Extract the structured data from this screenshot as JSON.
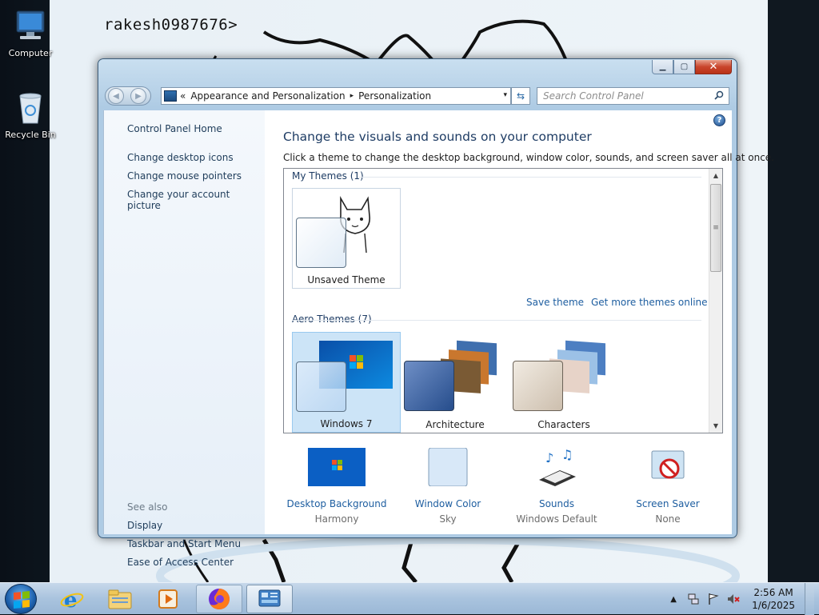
{
  "desktop": {
    "user_text": "rakesh0987676>",
    "icons": [
      {
        "label": "Computer",
        "icon": "computer-icon"
      },
      {
        "label": "Recycle Bin",
        "icon": "recycle-bin-icon"
      }
    ]
  },
  "window": {
    "caption_buttons": {
      "minimize": "minimize-icon",
      "maximize": "maximize-icon",
      "close": "close-icon"
    },
    "address": {
      "overflow": "«",
      "crumbs": [
        "Appearance and Personalization",
        "Personalization"
      ],
      "separator": "▸",
      "dropdown": "▾"
    },
    "search": {
      "placeholder": "Search Control Panel"
    },
    "left_pane": {
      "home": "Control Panel Home",
      "links": [
        "Change desktop icons",
        "Change mouse pointers",
        "Change your account picture"
      ],
      "see_also_label": "See also",
      "see_also": [
        "Display",
        "Taskbar and Start Menu",
        "Ease of Access Center"
      ]
    },
    "main": {
      "title": "Change the visuals and sounds on your computer",
      "subtitle": "Click a theme to change the desktop background, window color, sounds, and screen saver all at once.",
      "my_themes_header": "My Themes (1)",
      "my_themes": [
        {
          "label": "Unsaved Theme"
        }
      ],
      "save_theme": "Save theme",
      "get_more": "Get more themes online",
      "aero_header": "Aero Themes (7)",
      "aero_themes": [
        {
          "label": "Windows 7",
          "selected": true
        },
        {
          "label": "Architecture",
          "selected": false
        },
        {
          "label": "Characters",
          "selected": false
        }
      ],
      "bottom": [
        {
          "link": "Desktop Background",
          "value": "Harmony",
          "icon": "desktop-background-icon"
        },
        {
          "link": "Window Color",
          "value": "Sky",
          "icon": "window-color-icon"
        },
        {
          "link": "Sounds",
          "value": "Windows Default",
          "icon": "sounds-icon"
        },
        {
          "link": "Screen Saver",
          "value": "None",
          "icon": "screen-saver-icon"
        }
      ],
      "help": "?"
    }
  },
  "taskbar": {
    "pinned": [
      "internet-explorer-icon",
      "windows-explorer-icon",
      "media-player-icon",
      "firefox-icon",
      "control-panel-icon"
    ],
    "clock": {
      "time": "2:56 AM",
      "date": "1/6/2025"
    }
  },
  "colors": {
    "link": "#1e5ea0",
    "title": "#1e3c64",
    "selected_tile": "#cce4f7"
  }
}
